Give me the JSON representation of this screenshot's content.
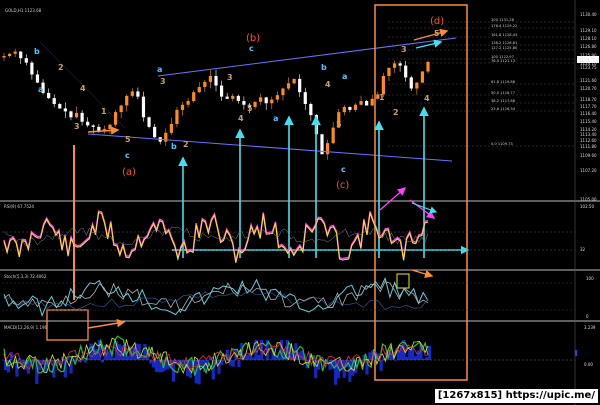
{
  "symbol_label": "GOLD,H1 1123.68",
  "watermark": "[1267x815] https://upic.me/",
  "price_axis": {
    "labels": [
      "1130.40",
      "1129.10",
      "1128.10",
      "1126.80",
      "1125.90",
      "1124.10",
      "1123.75",
      "1121.60",
      "1120.70",
      "1118.70",
      "1117.70",
      "1116.40",
      "1115.40",
      "1114.20",
      "1113.40",
      "1112.60",
      "1111.80",
      "1109.60",
      "1107.20",
      "1105.00"
    ],
    "current_price": "1123.75"
  },
  "fib_levels": [
    {
      "label": "100  1131.28",
      "color": "#888888"
    },
    {
      "label": "176.4  1129.22",
      "color": "#888888"
    },
    {
      "label": "161.8  1128.43",
      "color": "#888888"
    },
    {
      "label": "138.2  1126.61",
      "color": "#888888"
    },
    {
      "label": "127.2  1125.80",
      "color": "#888888"
    },
    {
      "label": "100  1122.97",
      "color": "#888888"
    },
    {
      "label": "76.4  1121.13",
      "color": "#888888"
    },
    {
      "label": "61.8  1119.86",
      "color": "#888888"
    },
    {
      "label": "50.0  1118.77",
      "color": "#888888"
    },
    {
      "label": "38.2  1117.68",
      "color": "#888888"
    },
    {
      "label": "23.6  1116.34",
      "color": "#888888"
    },
    {
      "label": "0.0  1109.73",
      "color": "#888888"
    }
  ],
  "wave_labels": [
    {
      "text": "b",
      "color": "#4fc3ff"
    },
    {
      "text": "a",
      "color": "#4fc3ff"
    },
    {
      "text": "2",
      "color": "#c8a060"
    },
    {
      "text": "4",
      "color": "#c8a060"
    },
    {
      "text": "3",
      "color": "#c8a060"
    },
    {
      "text": "1",
      "color": "#c8a060"
    },
    {
      "text": "5",
      "color": "#c8a060"
    },
    {
      "text": "c",
      "color": "#4fc3ff"
    },
    {
      "text": "(a)",
      "color": "#ff5030"
    },
    {
      "text": "a",
      "color": "#4fc3ff"
    },
    {
      "text": "3",
      "color": "#c8a060"
    },
    {
      "text": "b",
      "color": "#4fc3ff"
    },
    {
      "text": "2",
      "color": "#c8a060"
    },
    {
      "text": "4",
      "color": "#c8a060"
    },
    {
      "text": "3",
      "color": "#c8a060"
    },
    {
      "text": "c",
      "color": "#4fc3ff"
    },
    {
      "text": "(b)",
      "color": "#ff5030"
    },
    {
      "text": "5",
      "color": "#c8a060"
    },
    {
      "text": "a",
      "color": "#4fc3ff"
    },
    {
      "text": "b",
      "color": "#4fc3ff"
    },
    {
      "text": "a",
      "color": "#4fc3ff"
    },
    {
      "text": "4",
      "color": "#c8a060"
    },
    {
      "text": "5",
      "color": "#c8a060"
    },
    {
      "text": "c",
      "color": "#4fc3ff"
    },
    {
      "text": "(c)",
      "color": "#ff5030"
    },
    {
      "text": "1",
      "color": "#c8a060"
    },
    {
      "text": "2",
      "color": "#c8a060"
    },
    {
      "text": "3",
      "color": "#c8a060"
    },
    {
      "text": "5",
      "color": "#c8a060"
    },
    {
      "text": "4",
      "color": "#c8a060"
    },
    {
      "text": "(d)",
      "color": "#ff5030"
    }
  ],
  "panels": [
    {
      "label": "RSI(9) 67.7524",
      "axis": [
        "102.50",
        "32"
      ]
    },
    {
      "label": "Stoch(5,3,3) 72.4062",
      "axis": [
        "100",
        "0"
      ]
    },
    {
      "label": "MACD(12,26,9) 1.196",
      "axis": [
        "3.239",
        "0.00",
        "-1.633"
      ]
    }
  ],
  "colors": {
    "up_candle": "#ff8c1a",
    "down_candle": "#ffffff",
    "wave_blue": "#4fc3ff",
    "wave_red": "#ff5030",
    "highlight_box": "#ff8c3a",
    "arrow": "#40e0f0",
    "rsi": "#ffe020",
    "rsi2": "#ff40ff",
    "trendline": "#6a70ff"
  },
  "chart_data": {
    "type": "candlestick",
    "title": "GOLD,H1",
    "ylim": [
      1105,
      1131
    ],
    "indicators": [
      "RSI(9)",
      "Stoch(5,3,3)",
      "MACD(12,26,9)"
    ],
    "close_series": [
      1124.5,
      1124.8,
      1125.1,
      1124.2,
      1123.6,
      1122.0,
      1120.9,
      1119.5,
      1118.8,
      1118.0,
      1117.4,
      1117.0,
      1116.2,
      1116.8,
      1115.6,
      1115.1,
      1114.9,
      1114.3,
      1114.6,
      1115.2,
      1116.9,
      1117.8,
      1119.1,
      1119.7,
      1119.0,
      1116.2,
      1114.9,
      1113.5,
      1112.9,
      1114.1,
      1115.3,
      1117.2,
      1117.9,
      1118.4,
      1119.6,
      1120.3,
      1121.0,
      1121.8,
      1120.5,
      1119.0,
      1118.7,
      1119.1,
      1118.4,
      1117.9,
      1117.6,
      1118.3,
      1118.9,
      1118.1,
      1118.6,
      1119.2,
      1120.1,
      1120.8,
      1121.4,
      1119.6,
      1118.0,
      1116.5,
      1113.9,
      1111.2,
      1112.7,
      1114.8,
      1116.9,
      1117.6,
      1117.2,
      1117.9,
      1118.4,
      1117.8,
      1118.7,
      1119.3,
      1121.8,
      1122.9,
      1123.5,
      1123.2,
      1121.6,
      1120.1,
      1120.9,
      1122.4,
      1123.7
    ]
  }
}
